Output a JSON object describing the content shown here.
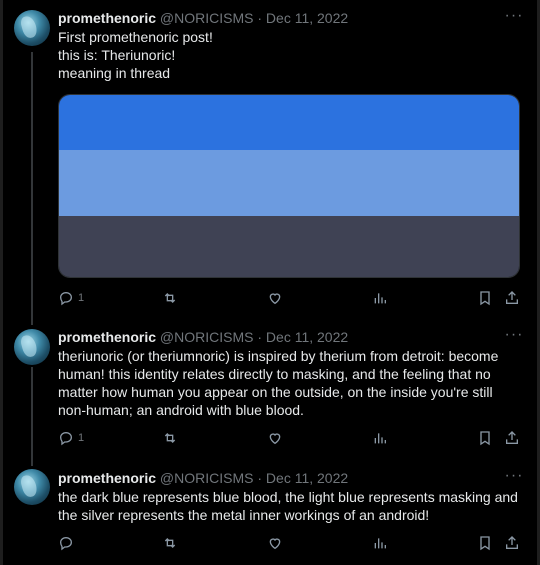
{
  "tweets": [
    {
      "name": "promethenoric",
      "handle": "@NORICISMS",
      "date": "Dec 11, 2022",
      "lines": [
        "First promethenoric post!",
        "this is: Theriunoric!",
        "meaning in thread"
      ],
      "replies": "1",
      "flag_colors": [
        "#2c72df",
        "#6c9be0",
        "#3f4254"
      ]
    },
    {
      "name": "promethenoric",
      "handle": "@NORICISMS",
      "date": "Dec 11, 2022",
      "lines": [
        "theriunoric (or theriumnoric) is inspired by therium from detroit: become",
        "human! this identity relates directly to masking, and the feeling that no",
        "matter how human you appear on the outside, on the inside you're still",
        "non-human; an android with blue blood."
      ],
      "replies": "1"
    },
    {
      "name": "promethenoric",
      "handle": "@NORICISMS",
      "date": "Dec 11, 2022",
      "lines": [
        "the dark blue represents blue blood, the light blue represents masking and",
        "the silver represents the metal inner workings of an android!"
      ],
      "replies": ""
    }
  ],
  "separator": "·",
  "more_glyph": "···",
  "icons": [
    "reply-icon",
    "retweet-icon",
    "like-icon",
    "views-icon",
    "bookmark-icon",
    "share-icon"
  ]
}
